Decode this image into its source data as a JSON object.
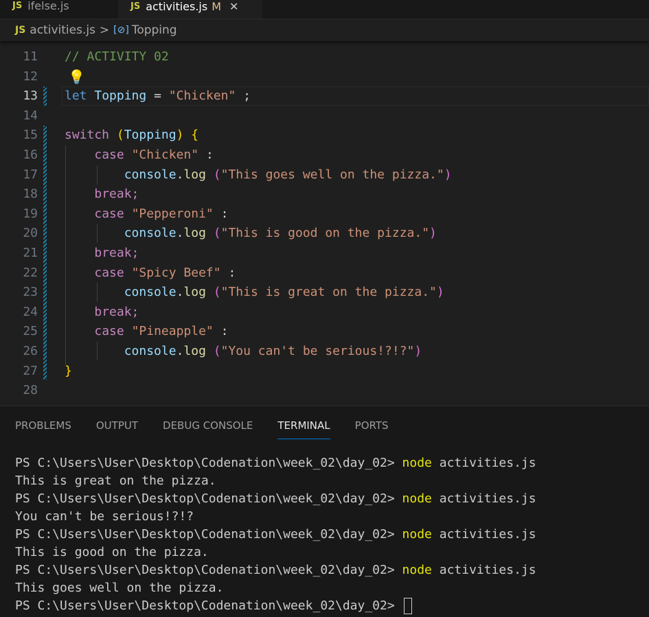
{
  "tabs": [
    {
      "badge": "JS",
      "name": "ifelse.js",
      "modified": "",
      "active": false
    },
    {
      "badge": "JS",
      "name": "activities.js",
      "modified": "M",
      "active": true
    }
  ],
  "breadcrumb": {
    "badge": "JS",
    "file": "activities.js",
    "sep": ">",
    "symbol": "Topping",
    "symbol_icon": "variable-icon"
  },
  "editor": {
    "line_numbers": [
      "11",
      "12",
      "13",
      "14",
      "15",
      "16",
      "17",
      "18",
      "19",
      "20",
      "21",
      "22",
      "23",
      "24",
      "25",
      "26",
      "27",
      "28"
    ],
    "active_line": "13",
    "comment": "// ACTIVITY 02",
    "let_kw": "let",
    "var_name": "Topping",
    "eq": "=",
    "init_str": "\"Chicken\"",
    "semi": ";",
    "switch_kw": "switch",
    "case_kw": "case",
    "break_kw": "break;",
    "console": "console",
    "log": "log",
    "cases": [
      {
        "label": "\"Chicken\"",
        "msg": "\"This goes well on the pizza.\""
      },
      {
        "label": "\"Pepperoni\"",
        "msg": "\"This is good on the pizza.\""
      },
      {
        "label": "\"Spicy Beef\"",
        "msg": "\"This is great on the pizza.\""
      },
      {
        "label": "\"Pineapple\"",
        "msg": "\"You can't be serious!?!?\""
      }
    ]
  },
  "panel": {
    "tabs": [
      "PROBLEMS",
      "OUTPUT",
      "DEBUG CONSOLE",
      "TERMINAL",
      "PORTS"
    ],
    "active_tab": "TERMINAL"
  },
  "terminal": {
    "prompt": "PS C:\\Users\\User\\Desktop\\Codenation\\week_02\\day_02> ",
    "cmd": "node",
    "arg": " activities.js",
    "outputs": [
      "This is great on the pizza.",
      "You can't be serious!?!?",
      "This is good on the pizza.",
      "This goes well on the pizza."
    ]
  },
  "colors": {
    "keyword": "#569cd6",
    "control": "#c586c0",
    "variable": "#9cdcfe",
    "string": "#ce9178",
    "comment": "#6a9955",
    "function": "#dcdcaa",
    "accent": "#0078d4"
  }
}
